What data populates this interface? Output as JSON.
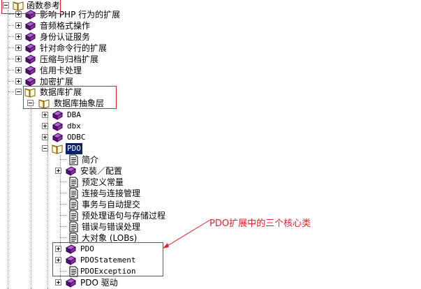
{
  "tree": {
    "root": "函数参考",
    "ext_items": [
      "影响 PHP 行为的扩展",
      "音频格式操作",
      "身份认证服务",
      "针对命令行的扩展",
      "压缩与归档扩展",
      "信用卡处理",
      "加密扩展"
    ],
    "db_ext": "数据库扩展",
    "abstraction": "数据库抽象层",
    "abs_items": [
      "DBA",
      "dbx",
      "ODBC"
    ],
    "pdo": "PDO",
    "pdo_children": {
      "intro": "简介",
      "install": "安装／配置",
      "constants": "预定义常量",
      "connections": "连接与连接管理",
      "transactions": "事务与自动提交",
      "prepared": "预处理语句与存储过程",
      "errors": "错误与错误处理",
      "lobs": "大对象 (LOBs)",
      "class_pdo": "PDO",
      "class_stmt": "PDOStatement",
      "class_exc": "PDOException",
      "drivers": "PDO 驱动"
    }
  },
  "annotation": {
    "text": "PDO扩展中的三个核心类",
    "color": "#e8202a"
  }
}
